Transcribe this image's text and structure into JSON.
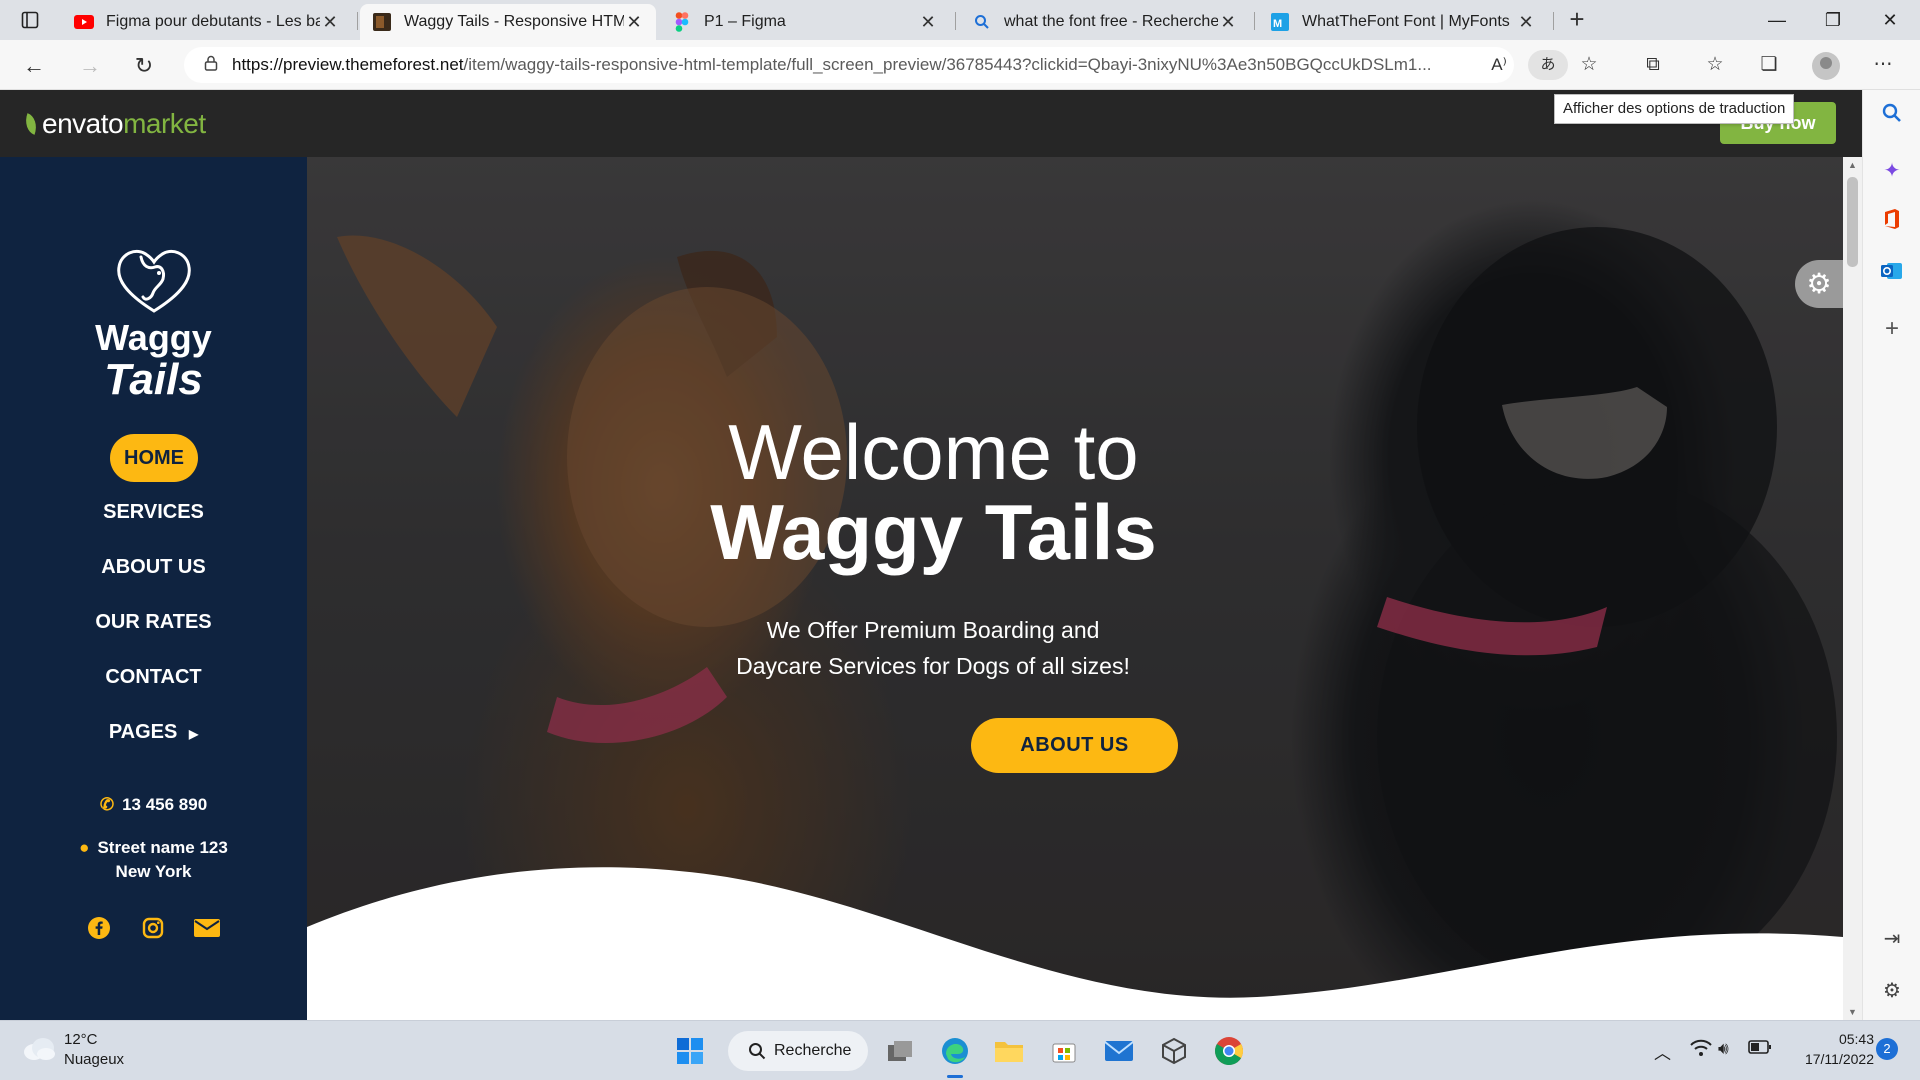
{
  "browser": {
    "tabs": [
      {
        "title": "Figma pour debutants - Les base",
        "favicon": "youtube-icon",
        "active": false
      },
      {
        "title": "Waggy Tails - Responsive HTML T",
        "favicon": "themeforest-icon",
        "active": true
      },
      {
        "title": "P1 – Figma",
        "favicon": "figma-icon",
        "active": false
      },
      {
        "title": "what the font free - Recherche",
        "favicon": "bing-search-icon",
        "active": false
      },
      {
        "title": "WhatTheFont Font | MyFonts",
        "favicon": "myfonts-icon",
        "active": false
      }
    ],
    "url_domain": "https://preview.themeforest.net",
    "url_path": "/item/waggy-tails-responsive-html-template/full_screen_preview/36785443?clickid=Qbayi-3nixyNU%3Ae3n50BGQccUkDSLm1...",
    "translate_tooltip": "Afficher des options de traduction"
  },
  "envato": {
    "logo_brand": "envato",
    "logo_market": "market",
    "buy_now": "Buy now",
    "brand_color": "#82b541"
  },
  "site": {
    "logo_line1": "Waggy",
    "logo_line2": "Tails",
    "nav": [
      {
        "label": "HOME",
        "active": true
      },
      {
        "label": "SERVICES"
      },
      {
        "label": "ABOUT US"
      },
      {
        "label": "OUR RATES"
      },
      {
        "label": "CONTACT"
      },
      {
        "label": "PAGES",
        "has_submenu": true
      }
    ],
    "phone": "13 456 890",
    "address_line1": "Street name 123",
    "address_line2": "New York",
    "social": [
      "facebook-icon",
      "instagram-icon",
      "envelope-icon"
    ],
    "accent": "#fdb812",
    "sidebar_color": "#0f2340"
  },
  "hero": {
    "title_line1": "Welcome to",
    "title_line2": "Waggy Tails",
    "subtitle": "We Offer Premium Boarding and Daycare Services for Dogs of all sizes!",
    "cta": "ABOUT US"
  },
  "taskbar": {
    "weather_temp": "12°C",
    "weather_desc": "Nuageux",
    "search_label": "Recherche",
    "time": "05:43",
    "date": "17/11/2022",
    "notifications": "2"
  }
}
